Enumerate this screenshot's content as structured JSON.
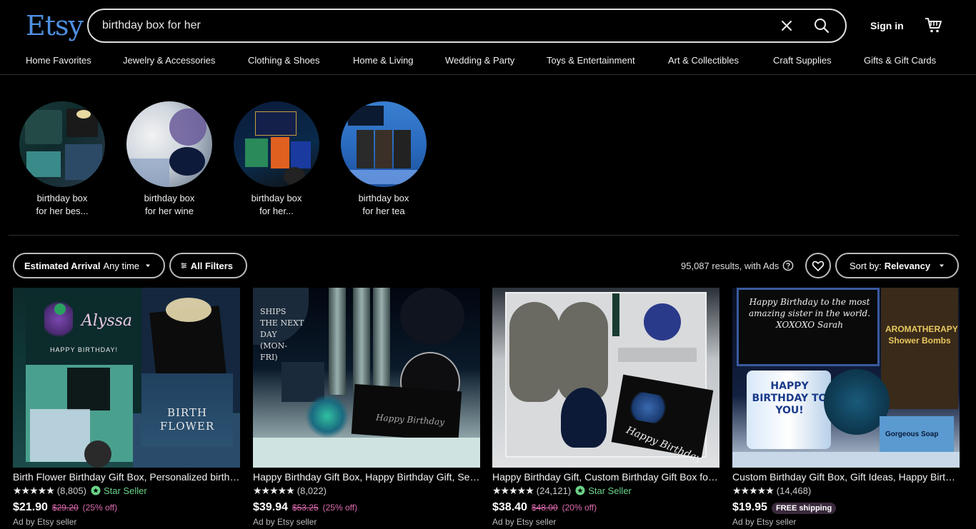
{
  "header": {
    "logo": "Etsy",
    "search_value": "birthday box for her",
    "signin_label": "Sign in",
    "accent": "#4f8fe0"
  },
  "nav": [
    "Home Favorites",
    "Jewelry & Accessories",
    "Clothing & Shoes",
    "Home & Living",
    "Wedding & Party",
    "Toys & Entertainment",
    "Art & Collectibles",
    "Craft Supplies",
    "Gifts & Gift Cards"
  ],
  "related": [
    {
      "label1": "birthday box",
      "label2": "for her bes..."
    },
    {
      "label1": "birthday box",
      "label2": "for her wine"
    },
    {
      "label1": "birthday box",
      "label2": "for her..."
    },
    {
      "label1": "birthday box",
      "label2": "for her tea"
    }
  ],
  "filters": {
    "arrival_bold": "Estimated Arrival",
    "arrival_value": "Any time",
    "all_filters": "All Filters",
    "results": "95,087 results, with Ads",
    "sort_label": "Sort by:",
    "sort_value": "Relevancy"
  },
  "listings": [
    {
      "title": "Birth Flower Birthday Gift Box, Personalized birthday box for her",
      "reviews": "(8,805)",
      "star_seller": "Star Seller",
      "price": "$21.90",
      "original": "$29.20",
      "discount": "(25% off)",
      "ad": "Ad by Etsy seller"
    },
    {
      "title": "Happy Birthday Gift Box, Happy Birthday Gift, Self Care Box",
      "reviews": "(8,022)",
      "star_seller": "",
      "price": "$39.94",
      "original": "$53.25",
      "discount": "(25% off)",
      "ad": "Ad by Etsy seller"
    },
    {
      "title": "Happy Birthday Gift, Custom Birthday Gift Box for her",
      "reviews": "(24,121)",
      "star_seller": "Star Seller",
      "price": "$38.40",
      "original": "$48.00",
      "discount": "(20% off)",
      "ad": "Ad by Etsy seller"
    },
    {
      "title": "Custom Birthday Gift Box, Gift Ideas, Happy Birthday Box",
      "reviews": "(14,468)",
      "star_seller": "",
      "price": "$19.95",
      "free_shipping": "FREE shipping",
      "ad": "Ad by Etsy seller"
    }
  ],
  "image_text": {
    "card1_name": "Alyssa",
    "card1_greeting": "HAPPY BIRTHDAY!",
    "card1_birth": "BIRTH",
    "card1_flower": "FLOWER",
    "card2_ship": "SHIPS THE NEXT DAY (MON-FRI)",
    "card2_box": "Happy Birthday",
    "card4_note": "Happy Birthday to the most amazing sister in the world. XOXOXO Sarah",
    "card4_mug": "HAPPY BIRTHDAY TO YOU!",
    "card4_bag": "AROMATHERAPY Shower Bombs",
    "card4_soap": "Gorgeous Soap"
  }
}
